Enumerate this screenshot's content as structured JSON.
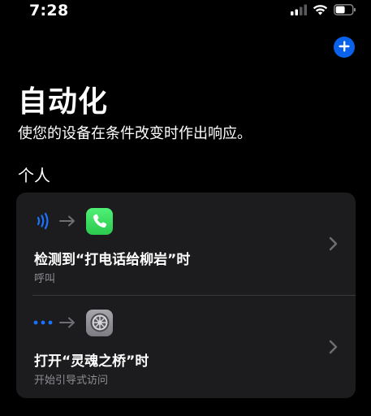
{
  "status_bar": {
    "time": "7:28"
  },
  "header": {
    "add_icon": "plus-icon"
  },
  "page": {
    "title": "自动化",
    "subtitle": "使您的设备在条件改变时作出响应。"
  },
  "section": {
    "title": "个人"
  },
  "automations": [
    {
      "trigger_icon": "nfc-icon",
      "app_icon": "phone-app-icon",
      "title": "检测到“打电话给柳岩”时",
      "subtitle": "呼叫"
    },
    {
      "trigger_icon": "more-dots-icon",
      "app_icon": "settings-app-icon",
      "title": "打开“灵魂之桥”时",
      "subtitle": "开始引导式访问"
    }
  ],
  "colors": {
    "background": "#000000",
    "card": "#1c1c1e",
    "accent_blue": "#0a62ea",
    "phone_green": "#34c759",
    "secondary_text": "#8e8e93"
  }
}
